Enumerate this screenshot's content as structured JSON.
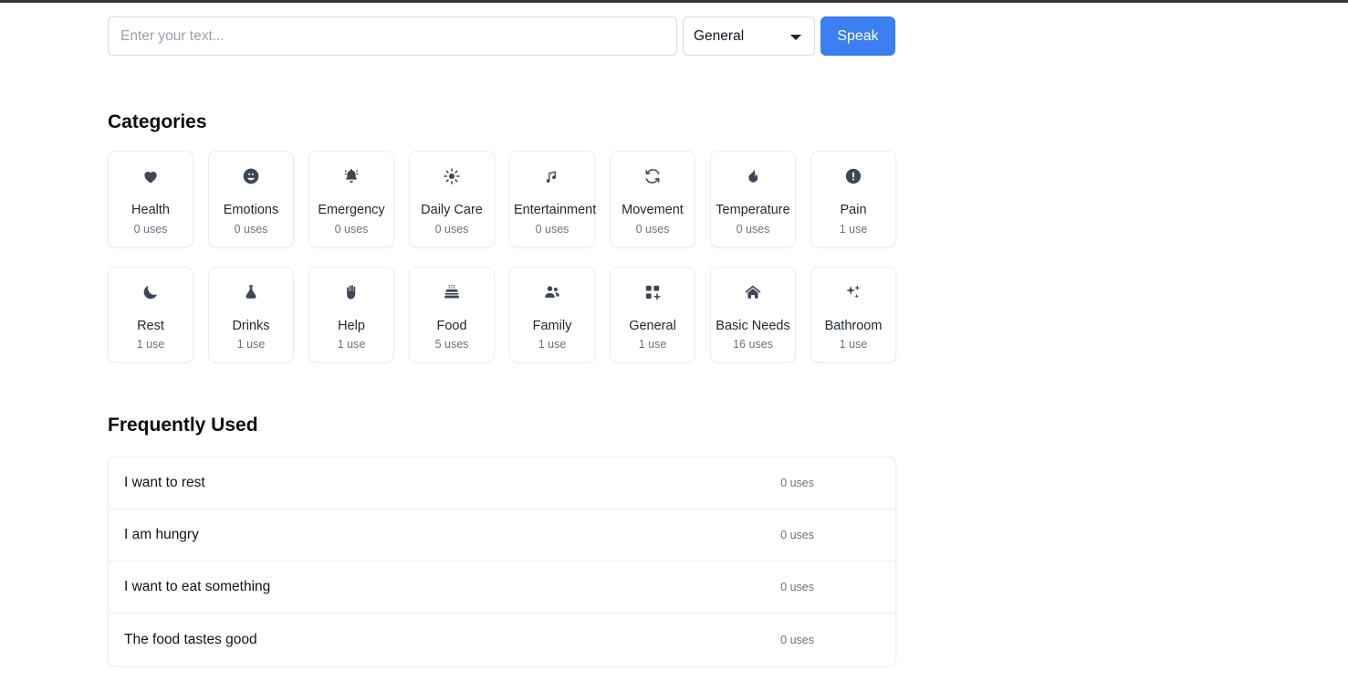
{
  "composer": {
    "input_placeholder": "Enter your text...",
    "input_value": "",
    "selected_category": "General",
    "speak_label": "Speak"
  },
  "categories": {
    "heading": "Categories",
    "items": [
      {
        "label": "Health",
        "uses": "0 uses",
        "icon": "heart-icon"
      },
      {
        "label": "Emotions",
        "uses": "0 uses",
        "icon": "smiley-icon"
      },
      {
        "label": "Emergency",
        "uses": "0 uses",
        "icon": "bell-icon"
      },
      {
        "label": "Daily Care",
        "uses": "0 uses",
        "icon": "sun-icon"
      },
      {
        "label": "Entertainment",
        "uses": "0 uses",
        "icon": "music-note-icon"
      },
      {
        "label": "Movement",
        "uses": "0 uses",
        "icon": "refresh-icon"
      },
      {
        "label": "Temperature",
        "uses": "0 uses",
        "icon": "flame-icon"
      },
      {
        "label": "Pain",
        "uses": "1 use",
        "icon": "exclamation-circle-icon"
      },
      {
        "label": "Rest",
        "uses": "1 use",
        "icon": "moon-icon"
      },
      {
        "label": "Drinks",
        "uses": "1 use",
        "icon": "flask-icon"
      },
      {
        "label": "Help",
        "uses": "1 use",
        "icon": "hand-icon"
      },
      {
        "label": "Food",
        "uses": "5 uses",
        "icon": "cake-icon"
      },
      {
        "label": "Family",
        "uses": "1 use",
        "icon": "people-icon"
      },
      {
        "label": "General",
        "uses": "1 use",
        "icon": "grid-plus-icon"
      },
      {
        "label": "Basic Needs",
        "uses": "16 uses",
        "icon": "home-icon"
      },
      {
        "label": "Bathroom",
        "uses": "1 use",
        "icon": "sparkles-icon"
      }
    ]
  },
  "frequently_used": {
    "heading": "Frequently Used",
    "rows": [
      {
        "text": "I want to rest",
        "uses": "0 uses"
      },
      {
        "text": "I am hungry",
        "uses": "0 uses"
      },
      {
        "text": "I want to eat something",
        "uses": "0 uses"
      },
      {
        "text": "The food tastes good",
        "uses": "0 uses"
      }
    ]
  },
  "colors": {
    "accent": "#3b7ff0",
    "icon": "#3e4657",
    "muted_text": "#6b7280",
    "topbar": "#333333"
  }
}
